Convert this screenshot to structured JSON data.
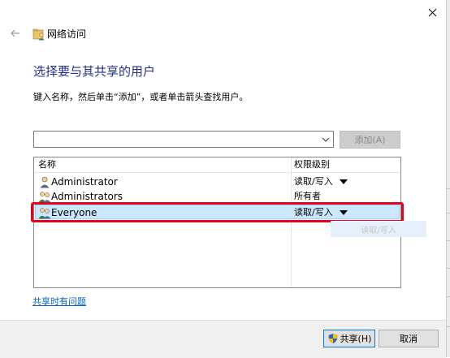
{
  "window": {
    "title": "网络访问"
  },
  "heading": "选择要与其共享的用户",
  "instruction": "键入名称，然后单击“添加”，或者单击箭头查找用户。",
  "name_input": {
    "value": ""
  },
  "add_button": "添加(A)",
  "table": {
    "columns": [
      "名称",
      "权限级别"
    ],
    "rows": [
      {
        "name": "Administrator",
        "permission": "读取/写入",
        "has_dropdown": true,
        "icon": "user-icon",
        "selected": false
      },
      {
        "name": "Administrators",
        "permission": "所有者",
        "has_dropdown": false,
        "icon": "group-icon",
        "selected": false
      },
      {
        "name": "Everyone",
        "permission": "读取/写入",
        "has_dropdown": true,
        "icon": "group-icon",
        "selected": true
      }
    ]
  },
  "background_ghost_text": "读取/写入",
  "help_link": "共享时有问题",
  "footer": {
    "share_button": "共享(H)",
    "cancel_button": "取消"
  },
  "colors": {
    "heading": "#1e3287",
    "selection": "#cce8ff",
    "highlight": "#e8001f",
    "link": "#0066cc"
  }
}
